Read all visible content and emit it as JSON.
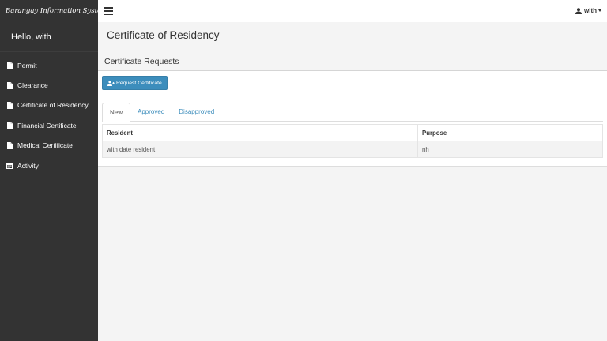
{
  "app": {
    "brand": "Barangay Information System"
  },
  "sidebar": {
    "greeting": "Hello, with",
    "items": [
      {
        "label": "Permit",
        "icon": "file-icon"
      },
      {
        "label": "Clearance",
        "icon": "file-icon"
      },
      {
        "label": "Certificate of Residency",
        "icon": "file-icon"
      },
      {
        "label": "Financial Certificate",
        "icon": "file-icon"
      },
      {
        "label": "Medical Certificate",
        "icon": "file-icon"
      },
      {
        "label": "Activity",
        "icon": "calendar-icon"
      }
    ]
  },
  "topbar": {
    "user": "with"
  },
  "main": {
    "title": "Certificate of Residency",
    "panel_title": "Certificate Requests",
    "request_button": "Request Certificate",
    "tabs": [
      {
        "label": "New",
        "active": true
      },
      {
        "label": "Approved",
        "active": false
      },
      {
        "label": "Disapproved",
        "active": false
      }
    ],
    "table": {
      "headers": [
        "Resident",
        "Purpose"
      ],
      "rows": [
        [
          "with date resident",
          "nh"
        ]
      ]
    }
  },
  "colors": {
    "sidebar": "#333333",
    "accent": "#3c8dbc",
    "background": "#f4f4f4"
  }
}
